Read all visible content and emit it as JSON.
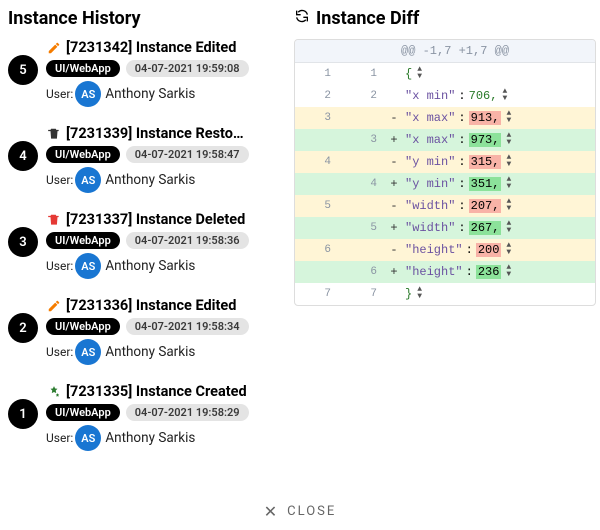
{
  "history_title": "Instance History",
  "diff_title": "Instance Diff",
  "close_label": "CLOSE",
  "user_label": "User:",
  "history": [
    {
      "step": "5",
      "icon": "edit",
      "title": "[7231342] Instance Edited",
      "source": "UI/WebApp",
      "timestamp": "04-07-2021 19:59:08",
      "user_initials": "AS",
      "user_name": "Anthony Sarkis"
    },
    {
      "step": "4",
      "icon": "restore",
      "title": "[7231339] Instance Resto…",
      "source": "UI/WebApp",
      "timestamp": "04-07-2021 19:58:47",
      "user_initials": "AS",
      "user_name": "Anthony Sarkis"
    },
    {
      "step": "3",
      "icon": "delete",
      "title": "[7231337] Instance Deleted",
      "source": "UI/WebApp",
      "timestamp": "04-07-2021 19:58:36",
      "user_initials": "AS",
      "user_name": "Anthony Sarkis"
    },
    {
      "step": "2",
      "icon": "edit",
      "title": "[7231336] Instance Edited",
      "source": "UI/WebApp",
      "timestamp": "04-07-2021 19:58:34",
      "user_initials": "AS",
      "user_name": "Anthony Sarkis"
    },
    {
      "step": "1",
      "icon": "create",
      "title": "[7231335] Instance Created",
      "source": "UI/WebApp",
      "timestamp": "04-07-2021 19:58:29",
      "user_initials": "AS",
      "user_name": "Anthony Sarkis"
    }
  ],
  "diff": {
    "hunk": "@@ -1,7 +1,7 @@",
    "rows": [
      {
        "old": "1",
        "new": "1",
        "sign": "",
        "cls": "",
        "key": "",
        "val": "{",
        "hl": "",
        "stepper": true
      },
      {
        "old": "2",
        "new": "2",
        "sign": "",
        "cls": "",
        "key": "\"x min\"",
        "val": "706,",
        "hl": "",
        "stepper": true
      },
      {
        "old": "3",
        "new": "",
        "sign": "-",
        "cls": "row-del",
        "key": "\"x max\"",
        "val": "913,",
        "hl": "del",
        "stepper": true
      },
      {
        "old": "",
        "new": "3",
        "sign": "+",
        "cls": "row-add",
        "key": "\"x max\"",
        "val": "973,",
        "hl": "add",
        "stepper": true
      },
      {
        "old": "4",
        "new": "",
        "sign": "-",
        "cls": "row-del",
        "key": "\"y min\"",
        "val": "315,",
        "hl": "del",
        "stepper": true
      },
      {
        "old": "",
        "new": "4",
        "sign": "+",
        "cls": "row-add",
        "key": "\"y min\"",
        "val": "351,",
        "hl": "add",
        "stepper": true
      },
      {
        "old": "5",
        "new": "",
        "sign": "-",
        "cls": "row-del",
        "key": "\"width\"",
        "val": "207,",
        "hl": "del",
        "stepper": true
      },
      {
        "old": "",
        "new": "5",
        "sign": "+",
        "cls": "row-add",
        "key": "\"width\"",
        "val": "267,",
        "hl": "add",
        "stepper": true
      },
      {
        "old": "6",
        "new": "",
        "sign": "-",
        "cls": "row-del",
        "key": "\"height\"",
        "val": "200",
        "hl": "del",
        "stepper": true
      },
      {
        "old": "",
        "new": "6",
        "sign": "+",
        "cls": "row-add",
        "key": "\"height\"",
        "val": "236",
        "hl": "add",
        "stepper": true
      },
      {
        "old": "7",
        "new": "7",
        "sign": "",
        "cls": "",
        "key": "",
        "val": "}",
        "hl": "",
        "stepper": true
      }
    ]
  }
}
